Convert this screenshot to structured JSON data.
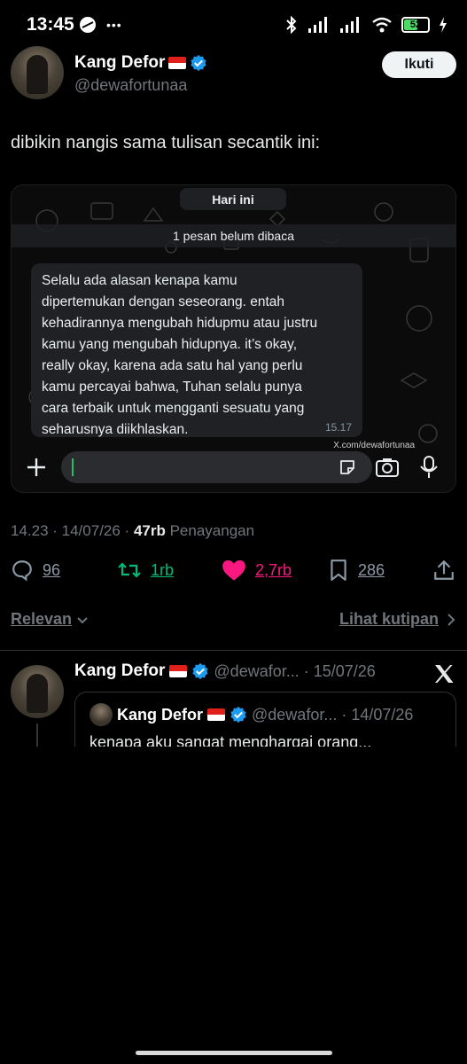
{
  "status_bar": {
    "time": "13:45",
    "battery_level": "52",
    "more_indicator": "•••"
  },
  "tweet": {
    "author": {
      "display_name": "Kang Defor",
      "handle": "@dewafortunaa",
      "verified": true
    },
    "follow_label": "Ikuti",
    "text": "dibikin nangis sama tulisan secantik ini:",
    "media": {
      "date_chip": "Hari ini",
      "unread_label": "1 pesan belum dibaca",
      "message_text": "Selalu ada alasan kenapa kamu\ndipertemukan dengan seseorang. entah\nkehadirannya mengubah hidupmu atau justru\nkamu yang mengubah hidupnya. it’s okay,\nreally okay, karena ada satu hal yang perlu\nkamu percayai bahwa, Tuhan selalu punya\ncara terbaik untuk mengganti sesuatu yang\nseharusnya diikhlaskan.",
      "message_time": "15.17",
      "watermark": "X.com/dewafortunaa"
    },
    "meta": {
      "time_date": "14.23 · 14/07/26 · ",
      "views_count": "47rb",
      "views_label": " Penayangan"
    },
    "actions": {
      "replies": "96",
      "reposts": "1rb",
      "likes": "2,7rb",
      "bookmarks": "286"
    }
  },
  "sort": {
    "relevance_label": "Relevan",
    "quotes_label": "Lihat kutipan"
  },
  "reply": {
    "display_name": "Kang Defor",
    "handle_date": "@dewafor... · 15/07/26",
    "quote": {
      "display_name": "Kang Defor",
      "handle_date": "@dewafor... · 14/07/26",
      "text": "kenapa aku sangat menghargai orang..."
    }
  },
  "colors": {
    "background": "#000000",
    "accent_green": "#00ba7c",
    "like_pink": "#f91880",
    "verified_blue": "#1d9bf0",
    "whatsapp_green": "#21c063"
  }
}
